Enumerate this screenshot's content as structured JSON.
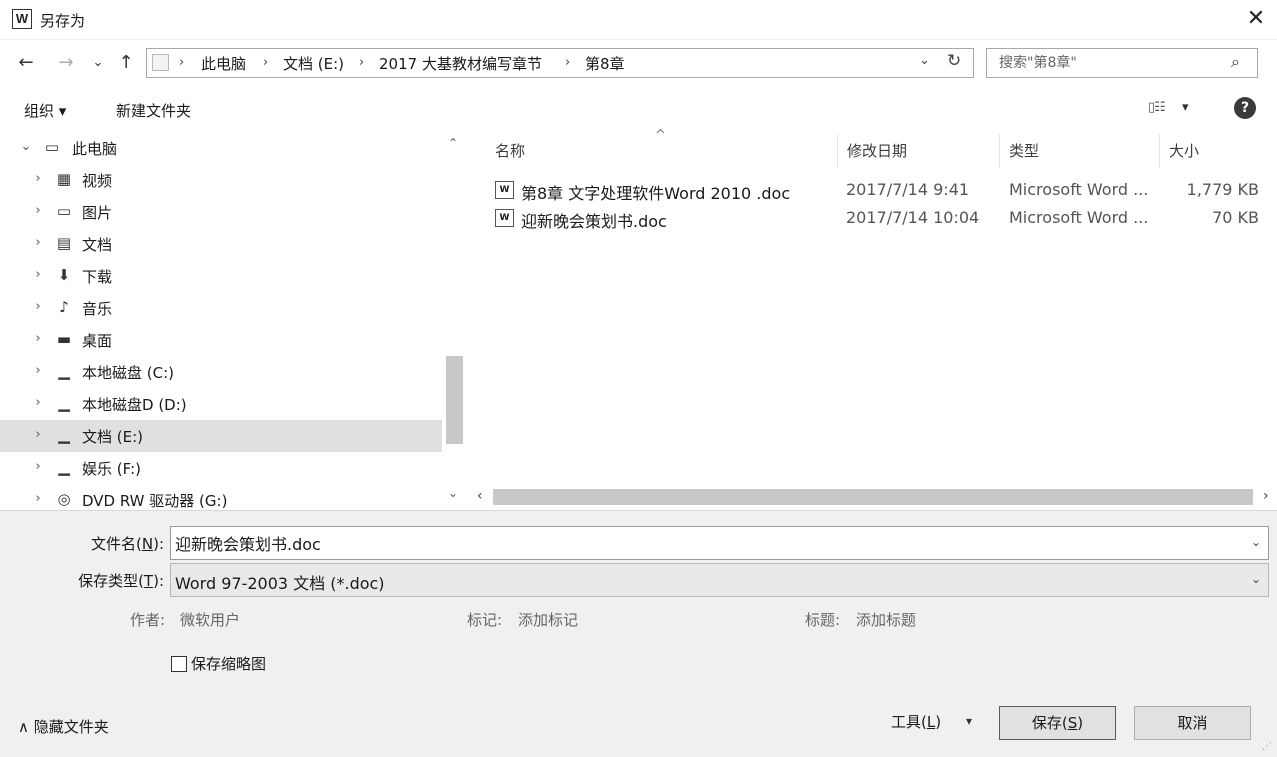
{
  "window": {
    "title": "另存为",
    "app_icon_letter": "W",
    "close_glyph": "✕"
  },
  "nav": {
    "back": "←",
    "forward": "→",
    "recent": "⌄",
    "up": "↑",
    "breadcrumbs": [
      "此电脑",
      "文档 (E:)",
      "2017 大基教材编写章节",
      "第8章"
    ],
    "crumb_separator": "›",
    "dropdown_glyph": "⌄",
    "refresh_glyph": "↻",
    "search_placeholder": "搜索\"第8章\"",
    "search_glyph": "⌕"
  },
  "toolbar": {
    "organize": "组织 ▾",
    "new_folder": "新建文件夹",
    "view_glyph": "▯☷",
    "view_arrow": "▾",
    "help": "?"
  },
  "tree": [
    {
      "label": "此电脑",
      "arrow": "⌄",
      "icon": "▭",
      "icon_name": "computer-icon",
      "indent": 0
    },
    {
      "label": "视频",
      "arrow": "›",
      "icon": "▦",
      "icon_name": "video-folder-icon",
      "indent": 1
    },
    {
      "label": "图片",
      "arrow": "›",
      "icon": "▭",
      "icon_name": "pictures-folder-icon",
      "indent": 1
    },
    {
      "label": "文档",
      "arrow": "›",
      "icon": "▤",
      "icon_name": "documents-folder-icon",
      "indent": 1
    },
    {
      "label": "下载",
      "arrow": "›",
      "icon": "⬇",
      "icon_name": "download-icon",
      "indent": 1
    },
    {
      "label": "音乐",
      "arrow": "›",
      "icon": "♪",
      "icon_name": "music-icon",
      "indent": 1
    },
    {
      "label": "桌面",
      "arrow": "›",
      "icon": "▬",
      "icon_name": "desktop-icon",
      "indent": 1
    },
    {
      "label": "本地磁盘 (C:)",
      "arrow": "›",
      "icon": "▁",
      "icon_name": "drive-icon",
      "indent": 1
    },
    {
      "label": "本地磁盘D (D:)",
      "arrow": "›",
      "icon": "▁",
      "icon_name": "drive-icon",
      "indent": 1
    },
    {
      "label": "文档 (E:)",
      "arrow": "›",
      "icon": "▁",
      "icon_name": "drive-icon",
      "indent": 1,
      "selected": true
    },
    {
      "label": "娱乐 (F:)",
      "arrow": "›",
      "icon": "▁",
      "icon_name": "drive-icon",
      "indent": 1
    },
    {
      "label": "DVD RW 驱动器 (G:)",
      "arrow": "›",
      "icon": "◎",
      "icon_name": "dvd-drive-icon",
      "indent": 1
    }
  ],
  "scroll": {
    "up": "⌃",
    "down": "⌄",
    "left": "‹",
    "right": "›"
  },
  "columns": {
    "sort_caret": "^",
    "name": "名称",
    "date": "修改日期",
    "type": "类型",
    "size": "大小"
  },
  "files": [
    {
      "name": "第8章 文字处理软件Word 2010 .doc",
      "date": "2017/7/14 9:41",
      "type": "Microsoft Word ...",
      "size": "1,779 KB",
      "icon": "W"
    },
    {
      "name": "迎新晚会策划书.doc",
      "date": "2017/7/14 10:04",
      "type": "Microsoft Word ...",
      "size": "70 KB",
      "icon": "W"
    }
  ],
  "form": {
    "filename_label": "文件名(",
    "filename_key": "N",
    "filename_label_end": "):",
    "filename_value": "迎新晚会策划书.doc",
    "filetype_label": "保存类型(",
    "filetype_key": "T",
    "filetype_label_end": "):",
    "filetype_value": "Word 97-2003 文档 (*.doc)",
    "combo_arrow": "⌄",
    "author_label": "作者:",
    "author_value": "微软用户",
    "tags_label": "标记:",
    "tags_value": "添加标记",
    "subject_label": "标题:",
    "subject_value": "添加标题",
    "thumbnail_label": "保存缩略图"
  },
  "footer": {
    "hide_folders": "∧ 隐藏文件夹",
    "tools": "工具(",
    "tools_key": "L",
    "tools_end": ")",
    "tools_arrow": "▾",
    "save": "保存(",
    "save_key": "S",
    "save_end": ")",
    "cancel": "取消",
    "grip": "⋰"
  }
}
